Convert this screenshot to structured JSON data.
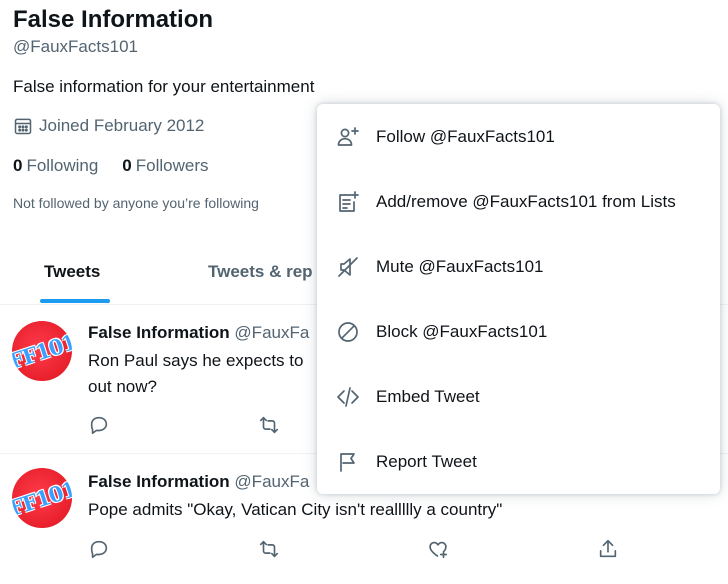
{
  "profile": {
    "name": "False Information",
    "handle": "@FauxFacts101",
    "bio": "False information for your entertainment",
    "joined": "Joined February 2012",
    "following_count": "0",
    "following_label": "Following",
    "followers_count": "0",
    "followers_label": "Followers",
    "not_followed": "Not followed by anyone you’re following"
  },
  "tabs": [
    {
      "label": "Tweets",
      "active": true
    },
    {
      "label": "Tweets & rep"
    }
  ],
  "tweets": [
    {
      "author": "False Information",
      "handle": "@FauxFa",
      "avatar_text": "FF101",
      "text": "Ron Paul says he expects to",
      "text2": "out now?"
    },
    {
      "author": "False Information",
      "handle": "@FauxFa",
      "avatar_text": "FF101",
      "text": "Pope admits \"Okay, Vatican City isn't reallllly a country\""
    }
  ],
  "menu": {
    "items": [
      {
        "icon": "follow-icon",
        "label": "Follow @FauxFacts101"
      },
      {
        "icon": "list-add-icon",
        "label": "Add/remove @FauxFacts101 from Lists"
      },
      {
        "icon": "mute-icon",
        "label": "Mute @FauxFacts101"
      },
      {
        "icon": "block-icon",
        "label": "Block @FauxFacts101"
      },
      {
        "icon": "embed-icon",
        "label": "Embed Tweet"
      },
      {
        "icon": "report-flag-icon",
        "label": "Report Tweet"
      }
    ]
  },
  "colors": {
    "accent": "#1d9bf0",
    "text_primary": "#0f1419",
    "text_secondary": "#536471"
  }
}
